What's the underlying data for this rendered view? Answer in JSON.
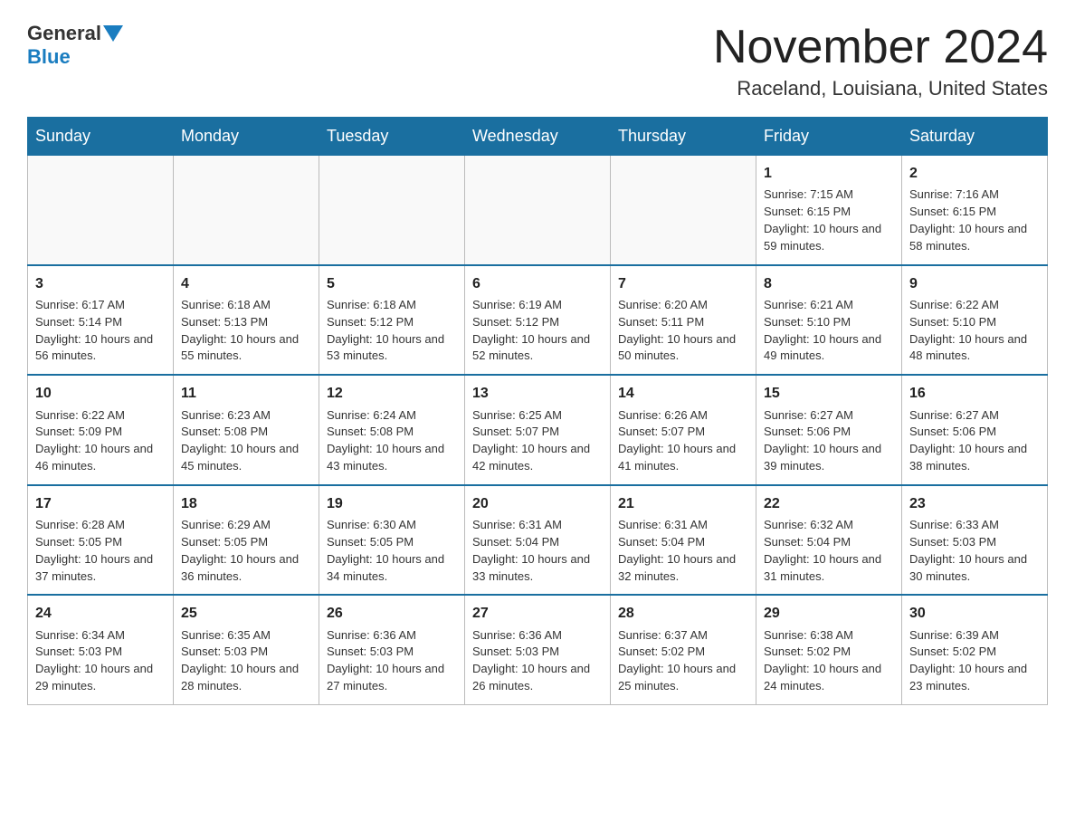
{
  "header": {
    "logo_general": "General",
    "logo_blue": "Blue",
    "month_title": "November 2024",
    "location": "Raceland, Louisiana, United States"
  },
  "days_of_week": [
    "Sunday",
    "Monday",
    "Tuesday",
    "Wednesday",
    "Thursday",
    "Friday",
    "Saturday"
  ],
  "weeks": [
    [
      {
        "day": "",
        "info": ""
      },
      {
        "day": "",
        "info": ""
      },
      {
        "day": "",
        "info": ""
      },
      {
        "day": "",
        "info": ""
      },
      {
        "day": "",
        "info": ""
      },
      {
        "day": "1",
        "info": "Sunrise: 7:15 AM\nSunset: 6:15 PM\nDaylight: 10 hours and 59 minutes."
      },
      {
        "day": "2",
        "info": "Sunrise: 7:16 AM\nSunset: 6:15 PM\nDaylight: 10 hours and 58 minutes."
      }
    ],
    [
      {
        "day": "3",
        "info": "Sunrise: 6:17 AM\nSunset: 5:14 PM\nDaylight: 10 hours and 56 minutes."
      },
      {
        "day": "4",
        "info": "Sunrise: 6:18 AM\nSunset: 5:13 PM\nDaylight: 10 hours and 55 minutes."
      },
      {
        "day": "5",
        "info": "Sunrise: 6:18 AM\nSunset: 5:12 PM\nDaylight: 10 hours and 53 minutes."
      },
      {
        "day": "6",
        "info": "Sunrise: 6:19 AM\nSunset: 5:12 PM\nDaylight: 10 hours and 52 minutes."
      },
      {
        "day": "7",
        "info": "Sunrise: 6:20 AM\nSunset: 5:11 PM\nDaylight: 10 hours and 50 minutes."
      },
      {
        "day": "8",
        "info": "Sunrise: 6:21 AM\nSunset: 5:10 PM\nDaylight: 10 hours and 49 minutes."
      },
      {
        "day": "9",
        "info": "Sunrise: 6:22 AM\nSunset: 5:10 PM\nDaylight: 10 hours and 48 minutes."
      }
    ],
    [
      {
        "day": "10",
        "info": "Sunrise: 6:22 AM\nSunset: 5:09 PM\nDaylight: 10 hours and 46 minutes."
      },
      {
        "day": "11",
        "info": "Sunrise: 6:23 AM\nSunset: 5:08 PM\nDaylight: 10 hours and 45 minutes."
      },
      {
        "day": "12",
        "info": "Sunrise: 6:24 AM\nSunset: 5:08 PM\nDaylight: 10 hours and 43 minutes."
      },
      {
        "day": "13",
        "info": "Sunrise: 6:25 AM\nSunset: 5:07 PM\nDaylight: 10 hours and 42 minutes."
      },
      {
        "day": "14",
        "info": "Sunrise: 6:26 AM\nSunset: 5:07 PM\nDaylight: 10 hours and 41 minutes."
      },
      {
        "day": "15",
        "info": "Sunrise: 6:27 AM\nSunset: 5:06 PM\nDaylight: 10 hours and 39 minutes."
      },
      {
        "day": "16",
        "info": "Sunrise: 6:27 AM\nSunset: 5:06 PM\nDaylight: 10 hours and 38 minutes."
      }
    ],
    [
      {
        "day": "17",
        "info": "Sunrise: 6:28 AM\nSunset: 5:05 PM\nDaylight: 10 hours and 37 minutes."
      },
      {
        "day": "18",
        "info": "Sunrise: 6:29 AM\nSunset: 5:05 PM\nDaylight: 10 hours and 36 minutes."
      },
      {
        "day": "19",
        "info": "Sunrise: 6:30 AM\nSunset: 5:05 PM\nDaylight: 10 hours and 34 minutes."
      },
      {
        "day": "20",
        "info": "Sunrise: 6:31 AM\nSunset: 5:04 PM\nDaylight: 10 hours and 33 minutes."
      },
      {
        "day": "21",
        "info": "Sunrise: 6:31 AM\nSunset: 5:04 PM\nDaylight: 10 hours and 32 minutes."
      },
      {
        "day": "22",
        "info": "Sunrise: 6:32 AM\nSunset: 5:04 PM\nDaylight: 10 hours and 31 minutes."
      },
      {
        "day": "23",
        "info": "Sunrise: 6:33 AM\nSunset: 5:03 PM\nDaylight: 10 hours and 30 minutes."
      }
    ],
    [
      {
        "day": "24",
        "info": "Sunrise: 6:34 AM\nSunset: 5:03 PM\nDaylight: 10 hours and 29 minutes."
      },
      {
        "day": "25",
        "info": "Sunrise: 6:35 AM\nSunset: 5:03 PM\nDaylight: 10 hours and 28 minutes."
      },
      {
        "day": "26",
        "info": "Sunrise: 6:36 AM\nSunset: 5:03 PM\nDaylight: 10 hours and 27 minutes."
      },
      {
        "day": "27",
        "info": "Sunrise: 6:36 AM\nSunset: 5:03 PM\nDaylight: 10 hours and 26 minutes."
      },
      {
        "day": "28",
        "info": "Sunrise: 6:37 AM\nSunset: 5:02 PM\nDaylight: 10 hours and 25 minutes."
      },
      {
        "day": "29",
        "info": "Sunrise: 6:38 AM\nSunset: 5:02 PM\nDaylight: 10 hours and 24 minutes."
      },
      {
        "day": "30",
        "info": "Sunrise: 6:39 AM\nSunset: 5:02 PM\nDaylight: 10 hours and 23 minutes."
      }
    ]
  ]
}
